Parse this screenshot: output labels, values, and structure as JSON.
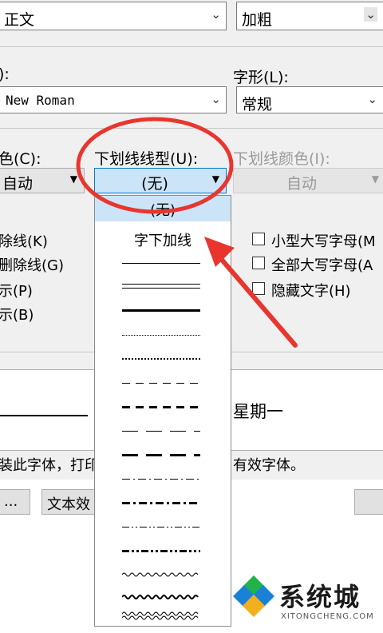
{
  "top": {
    "style_value": "正文",
    "weight_value": "加粗"
  },
  "font": {
    "label_cut": "):",
    "value": "New Roman",
    "style_label": "字形(L):",
    "style_value": "常规"
  },
  "underline": {
    "color_label_cut": "色(C):",
    "color_value_cut": "自动",
    "type_label": "下划线线型(U):",
    "type_value": "(无)",
    "line_color_label": "下划线颜色(I):",
    "line_color_value": "自动"
  },
  "dropdown": {
    "options": [
      "(无)",
      "字下加线"
    ]
  },
  "effects": {
    "left": [
      "除线(K)",
      "删除线(G)",
      "示(P)",
      "示(B)"
    ],
    "right": [
      "小型大写字母(M",
      "全部大写字母(A",
      "隐藏文字(H)"
    ]
  },
  "preview": {
    "sample_text": "星期一"
  },
  "info": {
    "left_text": "装此字体，打印",
    "right_text": "有效字体。"
  },
  "buttons": {
    "b1": "...",
    "b2": "文本效"
  },
  "watermark": {
    "brand": "系统城",
    "site": "XITONGCHENG.COM"
  },
  "colors": {
    "annotation": "#e8362f",
    "selection": "#cce4f7",
    "watermark_blue": "#1a82d6"
  }
}
